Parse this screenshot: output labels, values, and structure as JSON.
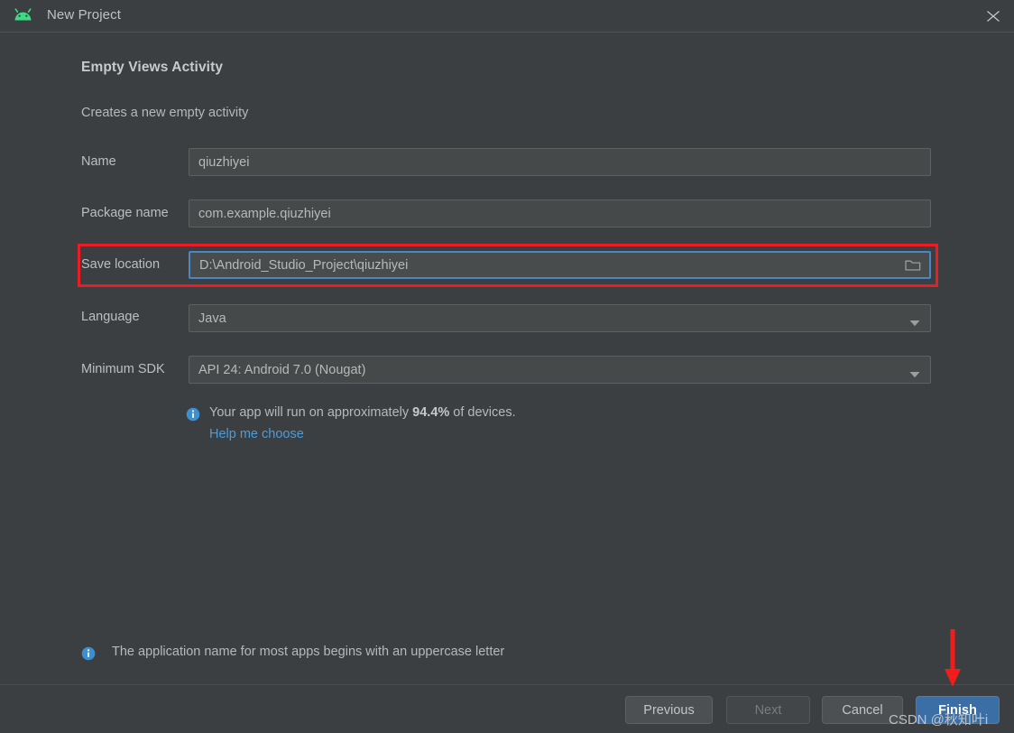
{
  "titlebar": {
    "title": "New Project",
    "app_icon": "android-robot-icon",
    "close_icon": "close-icon"
  },
  "form": {
    "heading": "Empty Views Activity",
    "subheading": "Creates a new empty activity",
    "fields": [
      {
        "label": "Name",
        "value": "qiuzhiyei",
        "type": "text"
      },
      {
        "label": "Package name",
        "value": "com.example.qiuzhiyei",
        "type": "text"
      },
      {
        "label": "Save location",
        "value": "D:\\Android_Studio_Project\\qiuzhiyei",
        "type": "path",
        "focused": true
      },
      {
        "label": "Language",
        "value": "Java",
        "type": "combo"
      },
      {
        "label": "Minimum SDK",
        "value": "API 24: Android 7.0 (Nougat)",
        "type": "combo"
      }
    ]
  },
  "info": {
    "prefix": "Your app will run on approximately ",
    "percent": "94.4%",
    "suffix": " of devices.",
    "link": "Help me choose",
    "icon": "info-icon"
  },
  "hint": {
    "text": "The application name for most apps begins with an uppercase letter",
    "icon": "info-icon"
  },
  "footer": {
    "previous": "Previous",
    "next": "Next",
    "cancel": "Cancel",
    "finish": "Finish"
  },
  "annotations": {
    "highlight_color": "#ec1c24",
    "arrow": "red-down-arrow"
  },
  "watermark": "CSDN @秋知叶i"
}
